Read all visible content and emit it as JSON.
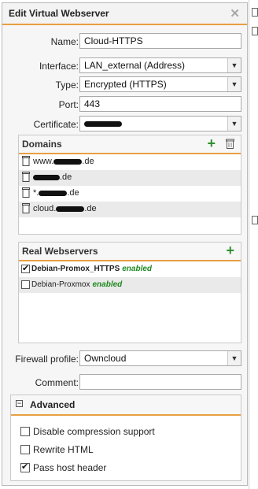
{
  "dialog": {
    "title": "Edit Virtual Webserver",
    "close_glyph": "✕"
  },
  "form": {
    "name_label": "Name:",
    "name_value": "Cloud-HTTPS",
    "interface_label": "Interface:",
    "interface_value": "LAN_external (Address)",
    "type_label": "Type:",
    "type_value": "Encrypted (HTTPS)",
    "port_label": "Port:",
    "port_value": "443",
    "certificate_label": "Certificate:",
    "firewall_label": "Firewall profile:",
    "firewall_value": "Owncloud",
    "comment_label": "Comment:",
    "comment_value": ""
  },
  "domains": {
    "title": "Domains",
    "items": [
      {
        "prefix": "www.",
        "suffix": ".de"
      },
      {
        "prefix": "",
        "suffix": ".de"
      },
      {
        "prefix": "*.",
        "suffix": ".de"
      },
      {
        "prefix": "cloud.",
        "suffix": ".de"
      }
    ]
  },
  "real_webservers": {
    "title": "Real Webservers",
    "items": [
      {
        "name": "Debian-Promox_HTTPS",
        "status": "enabled",
        "checked": true
      },
      {
        "name": "Debian-Proxmox",
        "status": "enabled",
        "checked": false
      }
    ]
  },
  "advanced": {
    "title": "Advanced",
    "collapse_glyph": "−",
    "options": [
      {
        "label": "Disable compression support",
        "checked": false
      },
      {
        "label": "Rewrite HTML",
        "checked": false
      },
      {
        "label": "Pass host header",
        "checked": true
      }
    ]
  },
  "icons": {
    "dropdown": "chevron-down-icon",
    "add": "plus-icon",
    "delete": "trash-icon"
  },
  "colors": {
    "accent": "#e89f43",
    "add": "#2f8f2f",
    "enabled": "#1f8a1f"
  }
}
